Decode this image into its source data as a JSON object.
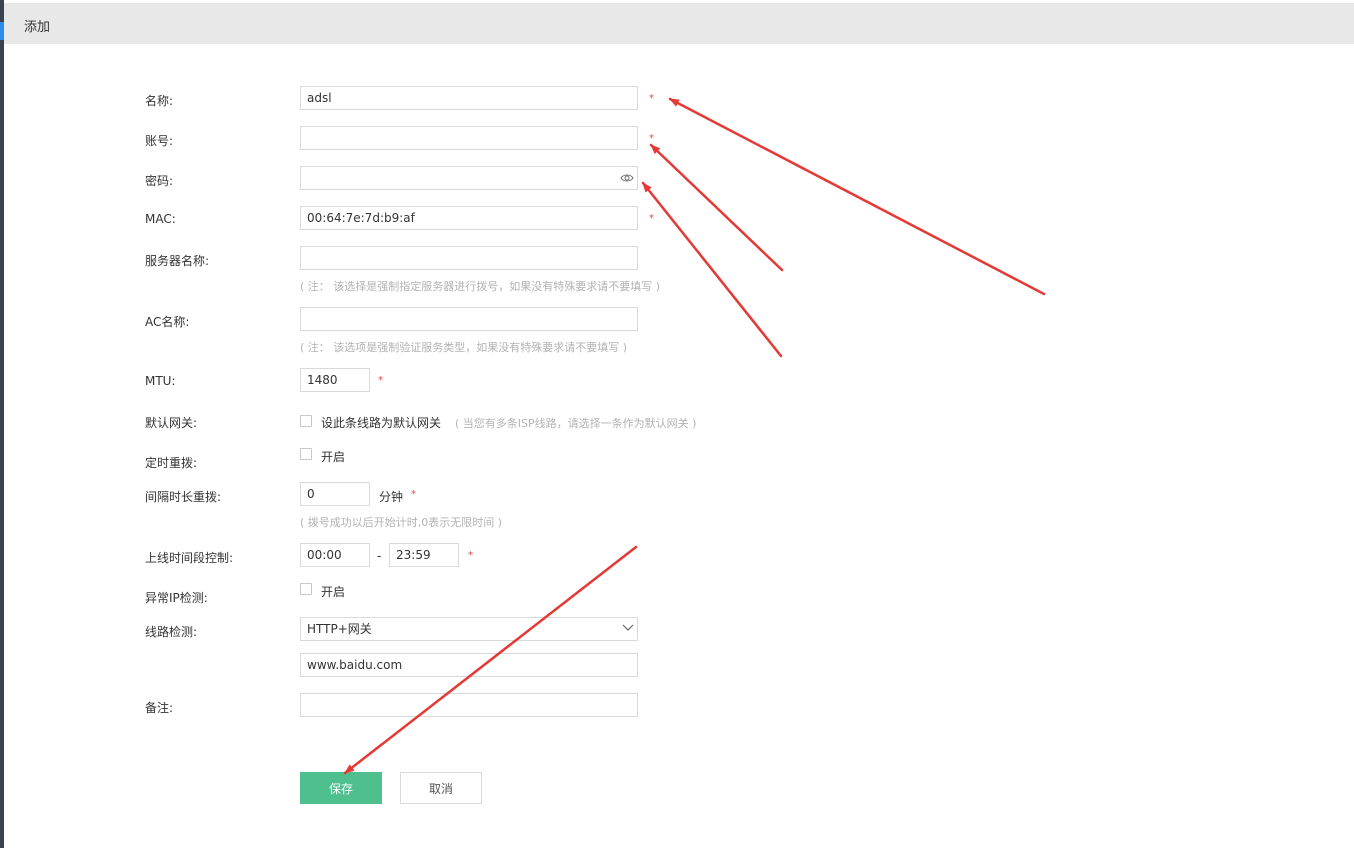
{
  "header": {
    "title": "添加"
  },
  "fields": {
    "name": {
      "label": "名称:",
      "value": "adsl"
    },
    "account": {
      "label": "账号:",
      "value": ""
    },
    "password": {
      "label": "密码:",
      "value": ""
    },
    "mac": {
      "label": "MAC:",
      "value": "00:64:7e:7d:b9:af"
    },
    "server_name": {
      "label": "服务器名称:",
      "value": "",
      "hint": "( 注： 该选择是强制指定服务器进行拨号，如果没有特殊要求请不要填写 )"
    },
    "ac_name": {
      "label": "AC名称:",
      "value": "",
      "hint": "( 注： 该选项是强制验证服务类型，如果没有特殊要求请不要填写 )"
    },
    "mtu": {
      "label": "MTU:",
      "value": "1480"
    },
    "default_gateway": {
      "label": "默认网关:",
      "checkbox_label": "设此条线路为默认网关",
      "hint": "( 当您有多条ISP线路，请选择一条作为默认网关 )",
      "checked": false
    },
    "scheduled_redial": {
      "label": "定时重拨:",
      "checkbox_label": "开启",
      "checked": false
    },
    "interval_redial": {
      "label": "间隔时长重拨:",
      "value": "0",
      "unit": "分钟",
      "hint": "( 拨号成功以后开始计时,0表示无限时间 )"
    },
    "online_time": {
      "label": "上线时间段控制:",
      "start": "00:00",
      "separator": "-",
      "end": "23:59"
    },
    "abnormal_ip": {
      "label": "异常IP检测:",
      "checkbox_label": "开启",
      "checked": false
    },
    "line_check": {
      "label": "线路检测:",
      "selected": "HTTP+网关",
      "url": "www.baidu.com"
    },
    "remark": {
      "label": "备注:",
      "value": ""
    }
  },
  "required_mark": "*",
  "buttons": {
    "save": "保存",
    "cancel": "取消"
  },
  "icons": {
    "password_toggle": "eye-icon",
    "select_toggle": "chevron-down-icon"
  },
  "colors": {
    "primary": "#4fc08d",
    "required": "#e64545",
    "annotation_arrow": "#e53935",
    "header_bg": "#e8e8e8"
  }
}
